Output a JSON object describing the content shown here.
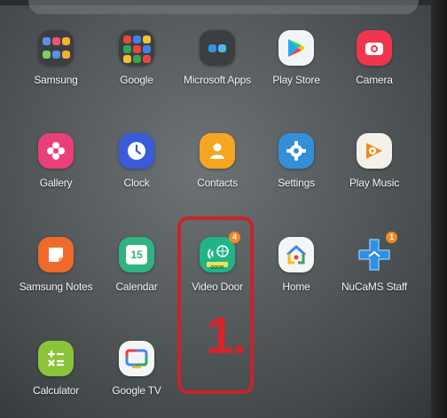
{
  "apps": [
    {
      "label": "Samsung"
    },
    {
      "label": "Google"
    },
    {
      "label": "Microsoft Apps"
    },
    {
      "label": "Play Store"
    },
    {
      "label": "Camera"
    },
    {
      "label": "Gallery"
    },
    {
      "label": "Clock"
    },
    {
      "label": "Contacts"
    },
    {
      "label": "Settings"
    },
    {
      "label": "Play Music"
    },
    {
      "label": "Samsung Notes"
    },
    {
      "label": "Calendar"
    },
    {
      "label": "Video Door",
      "badge": "4",
      "icon_text": "DOOR"
    },
    {
      "label": "Home"
    },
    {
      "label": "NuCaMS Staff",
      "badge": "1"
    },
    {
      "label": "Calculator"
    },
    {
      "label": "Google TV"
    }
  ],
  "calendar_day": "15",
  "annotation": "1.",
  "colors": {
    "highlight": "#c8242a",
    "badge": "#f08a24"
  }
}
